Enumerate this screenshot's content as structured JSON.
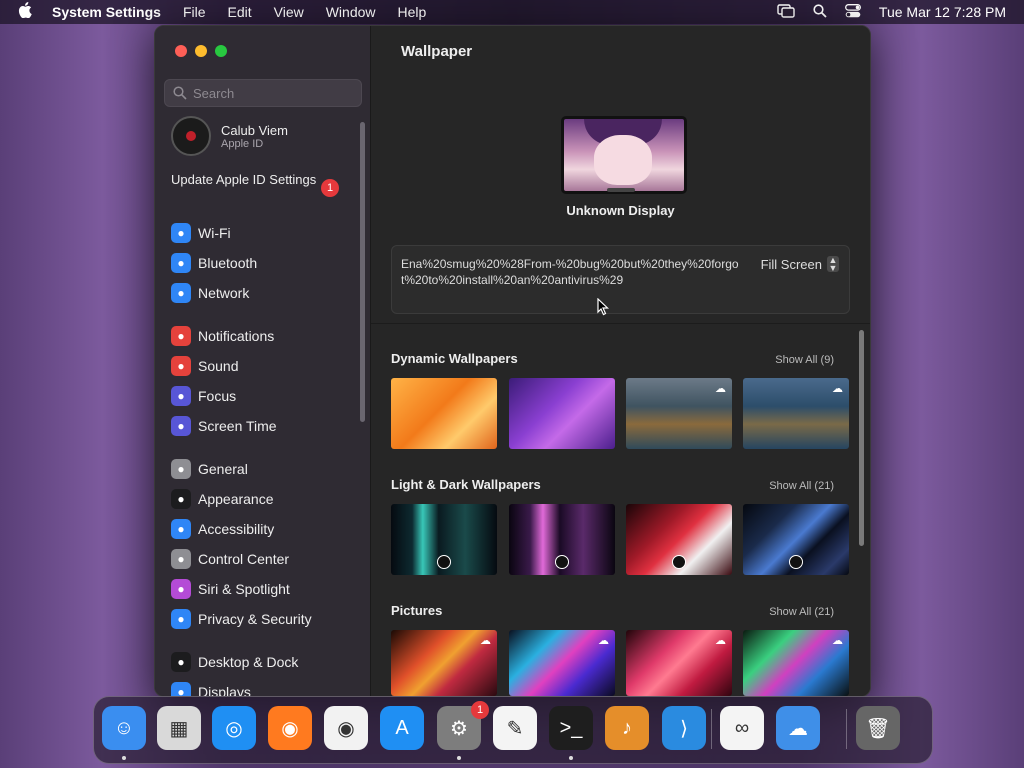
{
  "menubar": {
    "app_name": "System Settings",
    "menus": [
      "File",
      "Edit",
      "View",
      "Window",
      "Help"
    ],
    "clock": "Tue Mar 12  7:28 PM"
  },
  "sidebar": {
    "search_placeholder": "Search",
    "account": {
      "name": "Calub Viem",
      "subtitle": "Apple ID"
    },
    "update": {
      "label": "Update Apple ID Settings",
      "badge": "1"
    },
    "items": [
      {
        "label": "Wi-Fi",
        "icon": "wifi-icon",
        "color": "#2f86f6"
      },
      {
        "label": "Bluetooth",
        "icon": "bluetooth-icon",
        "color": "#2f86f6"
      },
      {
        "label": "Network",
        "icon": "globe-icon",
        "color": "#2f86f6"
      },
      {
        "label": "Notifications",
        "icon": "bell-icon",
        "color": "#e5423c"
      },
      {
        "label": "Sound",
        "icon": "speaker-icon",
        "color": "#e5423c"
      },
      {
        "label": "Focus",
        "icon": "moon-icon",
        "color": "#5856d6"
      },
      {
        "label": "Screen Time",
        "icon": "hourglass-icon",
        "color": "#5856d6"
      },
      {
        "label": "General",
        "icon": "gear-icon",
        "color": "#8e8e93"
      },
      {
        "label": "Appearance",
        "icon": "appearance-icon",
        "color": "#1c1c1e"
      },
      {
        "label": "Accessibility",
        "icon": "accessibility-icon",
        "color": "#2f86f6"
      },
      {
        "label": "Control Center",
        "icon": "toggles-icon",
        "color": "#8e8e93"
      },
      {
        "label": "Siri & Spotlight",
        "icon": "siri-icon",
        "color": "#b44bd6"
      },
      {
        "label": "Privacy & Security",
        "icon": "hand-icon",
        "color": "#2f86f6"
      },
      {
        "label": "Desktop & Dock",
        "icon": "dock-icon",
        "color": "#1c1c1e"
      },
      {
        "label": "Displays",
        "icon": "sun-icon",
        "color": "#2f86f6"
      }
    ]
  },
  "content": {
    "title": "Wallpaper",
    "display_name": "Unknown Display",
    "filename": "Ena%20smug%20%28From-%20bug%20but%20they%20forgot%20to%20install%20an%20antivirus%29",
    "fill_mode": "Fill Screen",
    "sections": [
      {
        "title": "Dynamic Wallpapers",
        "show_all": "Show All (9)"
      },
      {
        "title": "Light & Dark Wallpapers",
        "show_all": "Show All (21)"
      },
      {
        "title": "Pictures",
        "show_all": "Show All (21)"
      }
    ]
  },
  "dock": {
    "items": [
      {
        "name": "finder-icon",
        "color": "#3a8ef0",
        "glyph": "☺"
      },
      {
        "name": "launchpad-icon",
        "color": "#d9d9d9",
        "glyph": "▦"
      },
      {
        "name": "safari-icon",
        "color": "#1f8ff3",
        "glyph": "◎"
      },
      {
        "name": "firefox-icon",
        "color": "#ff7a1f",
        "glyph": "◉"
      },
      {
        "name": "chrome-icon",
        "color": "#f2f2f2",
        "glyph": "◉"
      },
      {
        "name": "app-store-icon",
        "color": "#1f8ff3",
        "glyph": "A"
      },
      {
        "name": "system-settings-icon",
        "color": "#7d7d7d",
        "glyph": "⚙"
      },
      {
        "name": "textedit-icon",
        "color": "#f4f4f4",
        "glyph": "✎"
      },
      {
        "name": "terminal-icon",
        "color": "#1e1e1e",
        "glyph": ">_"
      },
      {
        "name": "garageband-icon",
        "color": "#e58e2a",
        "glyph": "♪"
      },
      {
        "name": "vscode-icon",
        "color": "#2a8be0",
        "glyph": "⟩"
      },
      {
        "name": "visual-studio-icon",
        "color": "#f4f4f4",
        "glyph": "∞"
      },
      {
        "name": "weather-icon",
        "color": "#3f8fe8",
        "glyph": "☁"
      },
      {
        "name": "trash-icon",
        "color": "#666666",
        "glyph": "🗑"
      }
    ],
    "settings_badge": "1"
  }
}
